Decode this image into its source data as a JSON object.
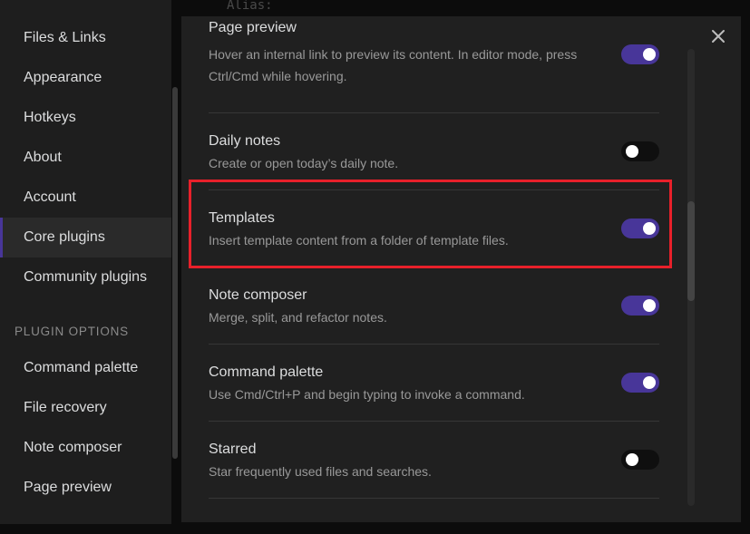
{
  "background_code": "Alias:",
  "sidebar": {
    "items": [
      {
        "label": "Files & Links"
      },
      {
        "label": "Appearance"
      },
      {
        "label": "Hotkeys"
      },
      {
        "label": "About"
      },
      {
        "label": "Account"
      },
      {
        "label": "Core plugins",
        "active": true
      },
      {
        "label": "Community plugins"
      }
    ],
    "section_title": "PLUGIN OPTIONS",
    "plugin_options": [
      {
        "label": "Command palette"
      },
      {
        "label": "File recovery"
      },
      {
        "label": "Note composer"
      },
      {
        "label": "Page preview"
      }
    ]
  },
  "settings": {
    "rows": [
      {
        "name": "Page preview",
        "desc_line1": "Hover an internal link to preview its content. In editor mode, press",
        "desc_line2": "Ctrl/Cmd while hovering.",
        "enabled": true
      },
      {
        "name": "Daily notes",
        "desc_line1": "Create or open today’s daily note.",
        "enabled": false
      },
      {
        "name": "Templates",
        "desc_line1": "Insert template content from a folder of template files.",
        "enabled": true
      },
      {
        "name": "Note composer",
        "desc_line1": "Merge, split, and refactor notes.",
        "enabled": true
      },
      {
        "name": "Command palette",
        "desc_line1": "Use Cmd/Ctrl+P and begin typing to invoke a command.",
        "enabled": true
      },
      {
        "name": "Starred",
        "desc_line1": "Star frequently used files and searches.",
        "enabled": false
      }
    ]
  },
  "colors": {
    "accent": "#483699",
    "highlight_border": "#e8202a",
    "panel_bg": "#202020",
    "sidebar_bg": "#1e1e1e"
  }
}
